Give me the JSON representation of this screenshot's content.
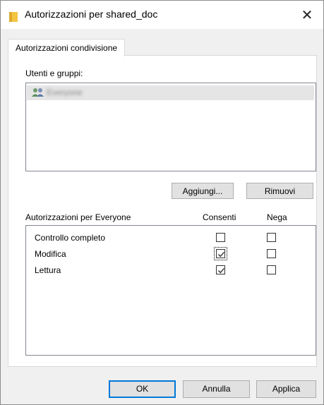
{
  "window": {
    "title": "Autorizzazioni per shared_doc",
    "close_glyph": "✕"
  },
  "tabs": [
    {
      "label": "Autorizzazioni condivisione",
      "selected": true
    }
  ],
  "users": {
    "label": "Utenti e gruppi:",
    "items": [
      {
        "name": "Everyone",
        "icon": "users-icon",
        "selected": true
      }
    ]
  },
  "buttons": {
    "add": "Aggiungi...",
    "remove": "Rimuovi"
  },
  "permissions": {
    "header": "Autorizzazioni per Everyone",
    "col_allow": "Consenti",
    "col_deny": "Nega",
    "rows": [
      {
        "name": "Controllo completo",
        "allow": false,
        "deny": false
      },
      {
        "name": "Modifica",
        "allow": true,
        "deny": false,
        "focused": true
      },
      {
        "name": "Lettura",
        "allow": true,
        "deny": false
      }
    ]
  },
  "footer": {
    "ok": "OK",
    "cancel": "Annulla",
    "apply": "Applica"
  }
}
